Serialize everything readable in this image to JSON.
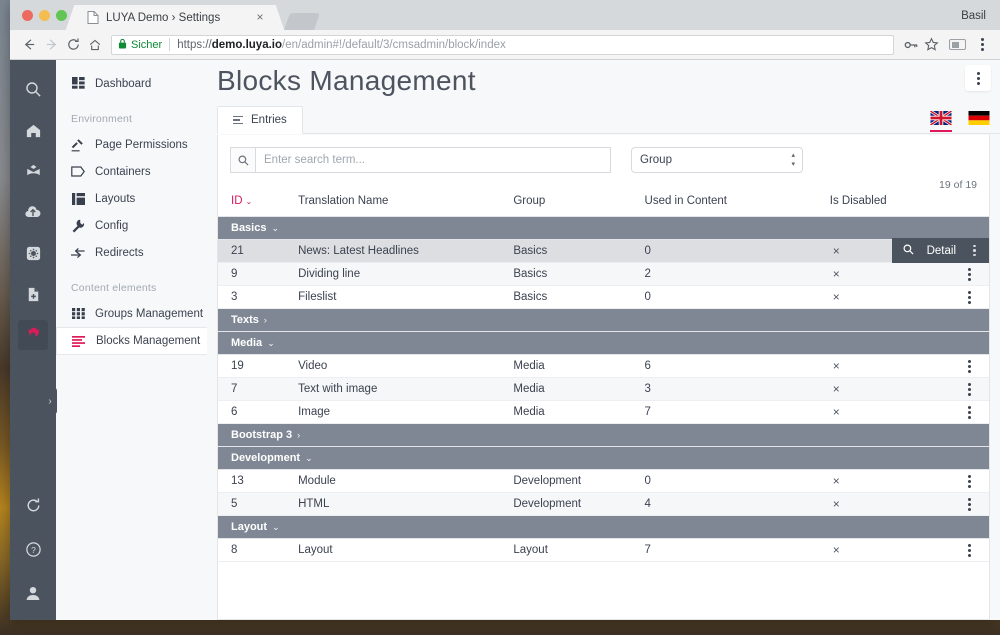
{
  "browser": {
    "tab_title": "LUYA Demo › Settings",
    "tab_favicon": "page-icon",
    "tab_close": "×",
    "profile_name": "Basil",
    "back_icon": "arrow-left-icon",
    "forward_icon": "arrow-right-icon",
    "reload_icon": "reload-icon",
    "home_icon": "home-icon",
    "secure_label": "Sicher",
    "lock_icon": "lock-icon",
    "url": {
      "scheme": "https://",
      "host": "demo.luya.io",
      "path": "/en/admin#!/default/3/cmsadmin/block/index"
    },
    "key_icon": "key-icon",
    "star_icon": "star-icon",
    "extension_icon": "extension-icon",
    "menu_icon": "kebab-menu-icon"
  },
  "rail": {
    "top_items": [
      {
        "name": "search-icon",
        "label": "Search",
        "active": false
      },
      {
        "name": "home-icon",
        "label": "Home",
        "active": false
      },
      {
        "name": "library-icon",
        "label": "Library",
        "active": false
      },
      {
        "name": "cloud-upload-icon",
        "label": "Upload",
        "active": false
      },
      {
        "name": "widget-icon",
        "label": "Modules",
        "active": false
      },
      {
        "name": "file-add-icon",
        "label": "New file",
        "active": false
      },
      {
        "name": "gear-icon",
        "label": "Settings",
        "active": true
      }
    ],
    "bottom_items": [
      {
        "name": "refresh-icon",
        "label": "Refresh"
      },
      {
        "name": "help-icon",
        "label": "Help"
      },
      {
        "name": "account-icon",
        "label": "Account"
      }
    ],
    "collapse_chevron": "›"
  },
  "sidebar": {
    "items": [
      {
        "label": "Dashboard",
        "icon": "dashboard-icon",
        "active": false
      },
      {
        "label": "Page Permissions",
        "icon": "hammer-icon",
        "active": false
      },
      {
        "label": "Containers",
        "icon": "tag-icon",
        "active": false
      },
      {
        "label": "Layouts",
        "icon": "columns-icon",
        "active": false
      },
      {
        "label": "Config",
        "icon": "wrench-icon",
        "active": false
      },
      {
        "label": "Redirects",
        "icon": "redirect-icon",
        "active": false
      },
      {
        "label": "Groups Management",
        "icon": "grid-icon",
        "active": false
      },
      {
        "label": "Blocks Management",
        "icon": "blocks-icon",
        "active": true
      }
    ],
    "section_environment": "Environment",
    "section_content_elements": "Content elements"
  },
  "main": {
    "page_title": "Blocks Management",
    "head_menu_icon": "kebab-menu-icon",
    "tab_entries": "Entries",
    "tab_entries_icon": "list-icon",
    "languages": [
      {
        "code": "en",
        "name": "uk-flag",
        "active": true
      },
      {
        "code": "de",
        "name": "german-flag",
        "active": false
      }
    ]
  },
  "filters": {
    "search_icon": "search-icon",
    "search_value": "",
    "search_placeholder": "Enter search term...",
    "group_select_value": "Group",
    "group_select_options": [
      "Group",
      "Basics",
      "Texts",
      "Media",
      "Bootstrap 3",
      "Development",
      "Layout"
    ],
    "stepper_up": "▴",
    "stepper_down": "▾"
  },
  "table": {
    "count_label": "19 of 19",
    "columns": [
      {
        "key": "id",
        "label": "ID",
        "sorted": true,
        "sort_chevron": "⌄"
      },
      {
        "key": "name",
        "label": "Translation Name",
        "sorted": false
      },
      {
        "key": "group",
        "label": "Group",
        "sorted": false
      },
      {
        "key": "used",
        "label": "Used in Content",
        "sorted": false
      },
      {
        "key": "disabled",
        "label": "Is Disabled",
        "sorted": false
      },
      {
        "key": "actions",
        "label": "",
        "sorted": false
      }
    ],
    "row_menu_icon": "kebab-menu-icon",
    "detail_button": {
      "label": "Detail",
      "icon": "magnifier-icon"
    },
    "chevron_expanded": "⌄",
    "chevron_collapsed": "›",
    "groups": [
      {
        "label": "Basics",
        "expanded": true,
        "rows": [
          {
            "id": "21",
            "name": "News: Latest Headlines",
            "group": "Basics",
            "used": "0",
            "disabled": "×",
            "hovered": true
          },
          {
            "id": "9",
            "name": "Dividing line",
            "group": "Basics",
            "used": "2",
            "disabled": "×",
            "hovered": false
          },
          {
            "id": "3",
            "name": "Fileslist",
            "group": "Basics",
            "used": "0",
            "disabled": "×",
            "hovered": false
          }
        ]
      },
      {
        "label": "Texts",
        "expanded": false,
        "rows": []
      },
      {
        "label": "Media",
        "expanded": true,
        "rows": [
          {
            "id": "19",
            "name": "Video",
            "group": "Media",
            "used": "6",
            "disabled": "×",
            "hovered": false
          },
          {
            "id": "7",
            "name": "Text with image",
            "group": "Media",
            "used": "3",
            "disabled": "×",
            "hovered": false
          },
          {
            "id": "6",
            "name": "Image",
            "group": "Media",
            "used": "7",
            "disabled": "×",
            "hovered": false
          }
        ]
      },
      {
        "label": "Bootstrap 3",
        "expanded": false,
        "rows": []
      },
      {
        "label": "Development",
        "expanded": true,
        "rows": [
          {
            "id": "13",
            "name": "Module",
            "group": "Development",
            "used": "0",
            "disabled": "×",
            "hovered": false
          },
          {
            "id": "5",
            "name": "HTML",
            "group": "Development",
            "used": "4",
            "disabled": "×",
            "hovered": false
          }
        ]
      },
      {
        "label": "Layout",
        "expanded": true,
        "rows": [
          {
            "id": "8",
            "name": "Layout",
            "group": "Layout",
            "used": "7",
            "disabled": "×",
            "hovered": false
          }
        ]
      }
    ]
  },
  "colors": {
    "accent": "#e01a59",
    "rail_bg": "#4b545e",
    "group_header_bg": "#7f8794",
    "page_bg": "#f7f8fa",
    "secure_green": "#0f8a35"
  }
}
